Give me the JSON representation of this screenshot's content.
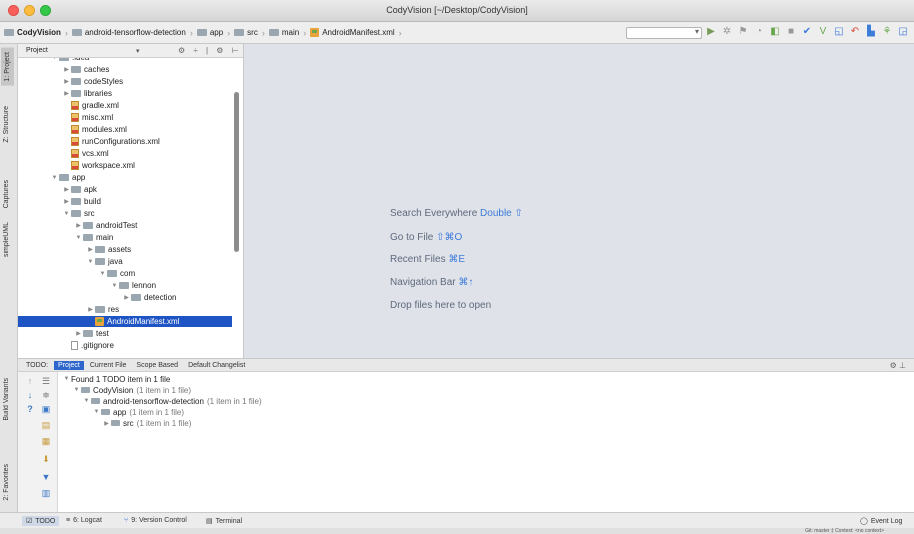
{
  "window": {
    "title": "CodyVision [~/Desktop/CodyVision]"
  },
  "breadcrumb": [
    "CodyVision",
    "android-tensorflow-detection",
    "app",
    "src",
    "main",
    "AndroidManifest.xml"
  ],
  "toolbar": {
    "icons": [
      "run-icon",
      "debug-icon",
      "coverage-icon",
      "profile-icon",
      "attach-icon",
      "stop-icon",
      "sync-icon",
      "avd-icon",
      "sdk-icon",
      "search-icon"
    ]
  },
  "left_strip": {
    "tabs": [
      "1: Project",
      "Z: Structure",
      "Captures",
      "simpleUML",
      "Build Variants",
      "2: Favorites"
    ]
  },
  "project_panel": {
    "title": "Project",
    "tree": [
      {
        "label": ".idea",
        "type": "folder",
        "depth": 1,
        "open": true
      },
      {
        "label": "caches",
        "type": "folder",
        "depth": 2,
        "open": false
      },
      {
        "label": "codeStyles",
        "type": "folder",
        "depth": 2,
        "open": false
      },
      {
        "label": "libraries",
        "type": "folder",
        "depth": 2,
        "open": false
      },
      {
        "label": "gradle.xml",
        "type": "xml",
        "depth": 2
      },
      {
        "label": "misc.xml",
        "type": "xml",
        "depth": 2
      },
      {
        "label": "modules.xml",
        "type": "xml",
        "depth": 2
      },
      {
        "label": "runConfigurations.xml",
        "type": "xml",
        "depth": 2
      },
      {
        "label": "vcs.xml",
        "type": "xml",
        "depth": 2
      },
      {
        "label": "workspace.xml",
        "type": "xml",
        "depth": 2
      },
      {
        "label": "app",
        "type": "folder",
        "depth": 1,
        "open": true
      },
      {
        "label": "apk",
        "type": "folder",
        "depth": 2,
        "open": false
      },
      {
        "label": "build",
        "type": "folder",
        "depth": 2,
        "open": false
      },
      {
        "label": "src",
        "type": "folder",
        "depth": 2,
        "open": true
      },
      {
        "label": "androidTest",
        "type": "folder",
        "depth": 3,
        "open": false
      },
      {
        "label": "main",
        "type": "folder",
        "depth": 3,
        "open": true
      },
      {
        "label": "assets",
        "type": "folder",
        "depth": 4,
        "open": false
      },
      {
        "label": "java",
        "type": "folder",
        "depth": 4,
        "open": true
      },
      {
        "label": "com",
        "type": "folder",
        "depth": 5,
        "open": true
      },
      {
        "label": "lennon",
        "type": "folder",
        "depth": 6,
        "open": true
      },
      {
        "label": "detection",
        "type": "folder",
        "depth": 7,
        "open": false
      },
      {
        "label": "res",
        "type": "folder",
        "depth": 4,
        "open": false
      },
      {
        "label": "AndroidManifest.xml",
        "type": "manifest",
        "depth": 4,
        "selected": true
      },
      {
        "label": "test",
        "type": "folder",
        "depth": 3,
        "open": false
      },
      {
        "label": ".gitignore",
        "type": "git",
        "depth": 2
      }
    ]
  },
  "editor": {
    "hints": [
      {
        "text": "Search Everywhere ",
        "key": "Double ⇧"
      },
      {
        "text": "Go to File ",
        "key": "⇧⌘O"
      },
      {
        "text": "Recent Files ",
        "key": "⌘E"
      },
      {
        "text": "Navigation Bar ",
        "key": "⌘↑"
      },
      {
        "text": "Drop files here to open",
        "key": ""
      }
    ]
  },
  "todo": {
    "label": "TODO:",
    "tabs": [
      "Project",
      "Current File",
      "Scope Based",
      "Default Changelist"
    ],
    "rows": [
      {
        "text": "Found 1 TODO item in 1 file",
        "extra": "",
        "depth": 0
      },
      {
        "text": "CodyVision",
        "extra": "(1 item in 1 file)",
        "depth": 1
      },
      {
        "text": "android-tensorflow-detection",
        "extra": "(1 item in 1 file)",
        "depth": 2
      },
      {
        "text": "app",
        "extra": "(1 item in 1 file)",
        "depth": 3
      },
      {
        "text": "src",
        "extra": "(1 item in 1 file)",
        "depth": 4
      }
    ]
  },
  "status": {
    "tabs": [
      "TODO",
      "6: Logcat",
      "9: Version Control",
      "Terminal"
    ],
    "event_log": "Event Log",
    "right_text": "Git: master ‡   Context: <no context>"
  }
}
